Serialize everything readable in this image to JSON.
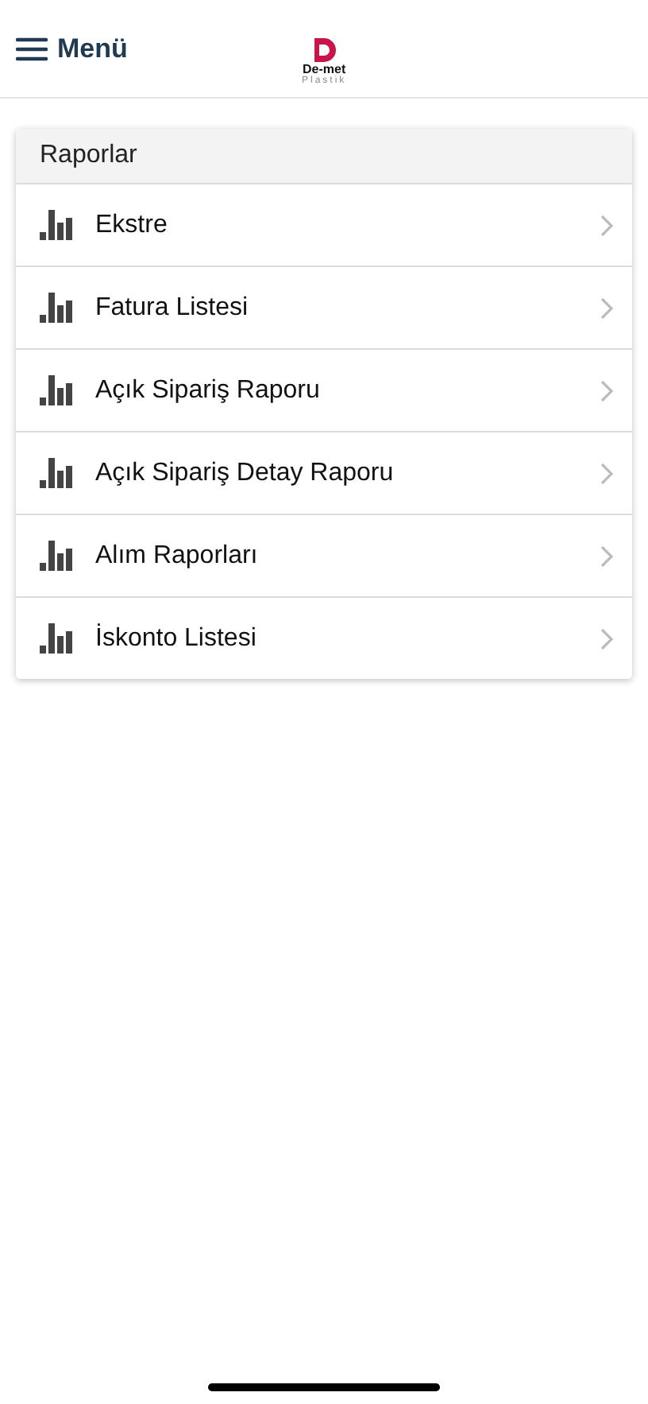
{
  "header": {
    "menu_label": "Menü",
    "logo": {
      "name": "De-met",
      "subtitle": "Plastik"
    }
  },
  "reports": {
    "title": "Raporlar",
    "items": [
      {
        "label": "Ekstre"
      },
      {
        "label": "Fatura Listesi"
      },
      {
        "label": "Açık Sipariş Raporu"
      },
      {
        "label": "Açık Sipariş Detay Raporu"
      },
      {
        "label": "Alım Raporları"
      },
      {
        "label": "İskonto Listesi"
      }
    ]
  }
}
